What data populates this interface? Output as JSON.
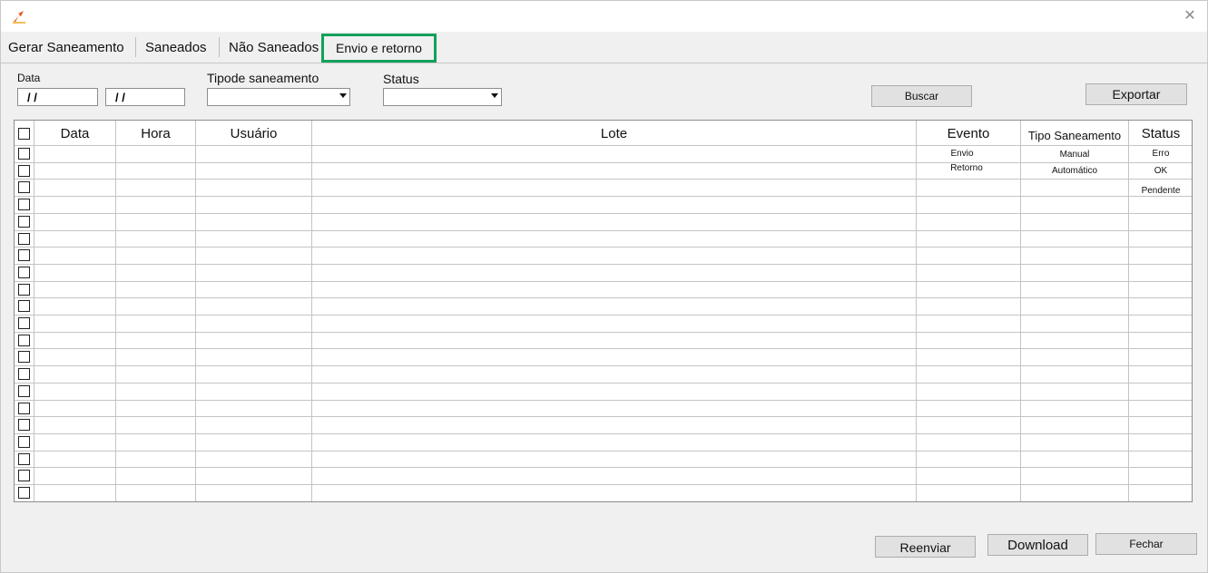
{
  "window": {
    "close_symbol": "✕"
  },
  "tabs": [
    {
      "label": "Gerar Saneamento"
    },
    {
      "label": "Saneados"
    },
    {
      "label": "Não Saneados"
    },
    {
      "label": "Envio e retorno",
      "active": true
    }
  ],
  "filters": {
    "data_label": "Data",
    "date_from": "/ /",
    "date_to": "/ /",
    "tipo_label": "Tipode saneamento",
    "tipo_value": "",
    "status_label": "Status",
    "status_value": ""
  },
  "buttons": {
    "buscar": "Buscar",
    "exportar": "Exportar",
    "reenviar": "Reenviar",
    "download": "Download",
    "fechar": "Fechar"
  },
  "table": {
    "columns": [
      "Data",
      "Hora",
      "Usuário",
      "Lote",
      "Evento",
      "Tipo Saneamento",
      "Status"
    ],
    "row_count": 21,
    "evento_options": [
      "Envio",
      "Retorno"
    ],
    "tipo_options": [
      "Manual",
      "Automático"
    ],
    "status_options": [
      "Erro",
      "OK",
      "Pendente"
    ]
  },
  "colors": {
    "active_tab_border": "#12a05c",
    "app_icon": "#e8541c"
  }
}
